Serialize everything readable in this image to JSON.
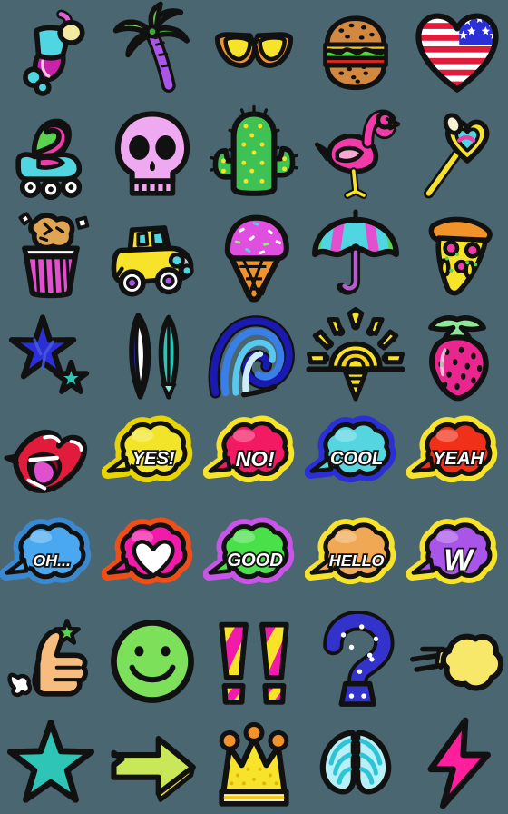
{
  "page": {
    "title": "Summer Vibes Emoji Sticker Sheet",
    "background_color": "#4a6670",
    "grid": {
      "columns": 5,
      "rows": 8,
      "cell_size_px": 112,
      "total_stickers": 40
    }
  },
  "palette": {
    "outline": "#111111",
    "cyan": "#4fd6e0",
    "magenta": "#cc22aa",
    "hot_pink": "#ff1e9c",
    "pink": "#f23aa8",
    "yellow": "#f7e32a",
    "gold": "#f5c518",
    "green": "#5ad44f",
    "leaf_green": "#57c04a",
    "blue": "#2b2fd6",
    "royal_blue": "#3333cc",
    "light_blue": "#4aa8f0",
    "orange": "#f0932b",
    "red": "#e8261c",
    "crimson": "#e01b3c",
    "purple": "#a855e8",
    "teal": "#2ec4b6",
    "skin": "#f7bd7f",
    "white": "#ffffff"
  },
  "stickers": [
    {
      "row": 1,
      "col": 1,
      "name": "cocktail-drink",
      "label": "Tropical Cocktail",
      "icon": "cocktail-icon",
      "colors": [
        "#4fd6e0",
        "#cc22aa",
        "#f7e8a0"
      ]
    },
    {
      "row": 1,
      "col": 2,
      "name": "palm-tree",
      "label": "Palm Tree",
      "icon": "palm-tree-icon",
      "colors": [
        "#57c04a",
        "#a855e8"
      ]
    },
    {
      "row": 1,
      "col": 3,
      "name": "sunglasses",
      "label": "Sunglasses",
      "icon": "sunglasses-icon",
      "colors": [
        "#f7e32a",
        "#f0932b"
      ]
    },
    {
      "row": 1,
      "col": 4,
      "name": "hamburger",
      "label": "Hamburger",
      "icon": "hamburger-icon",
      "colors": [
        "#d2883f",
        "#5ad44f",
        "#e8261c"
      ]
    },
    {
      "row": 1,
      "col": 5,
      "name": "usa-flag-heart",
      "label": "USA Flag Heart",
      "icon": "flag-heart-icon",
      "colors": [
        "#e01b3c",
        "#2b2fd6",
        "#ffffff"
      ]
    },
    {
      "row": 2,
      "col": 1,
      "name": "roller-skate",
      "label": "Roller Skate",
      "icon": "roller-skate-icon",
      "colors": [
        "#4fd6e0",
        "#f23aa8",
        "#5ad44f"
      ]
    },
    {
      "row": 2,
      "col": 2,
      "name": "skull",
      "label": "Skull",
      "icon": "skull-icon",
      "colors": [
        "#efa9f0"
      ]
    },
    {
      "row": 2,
      "col": 3,
      "name": "cactus",
      "label": "Cactus",
      "icon": "cactus-icon",
      "colors": [
        "#3fc253",
        "#f7e32a"
      ]
    },
    {
      "row": 2,
      "col": 4,
      "name": "flamingo",
      "label": "Flamingo",
      "icon": "flamingo-icon",
      "colors": [
        "#f23aa8",
        "#f9a8d4",
        "#f7e32a"
      ]
    },
    {
      "row": 2,
      "col": 5,
      "name": "heart-wand",
      "label": "Heart Magic Wand",
      "icon": "heart-wand-icon",
      "colors": [
        "#f7e32a",
        "#4fd6e0",
        "#f23aa8"
      ]
    },
    {
      "row": 3,
      "col": 1,
      "name": "popcorn",
      "label": "Popcorn Bucket",
      "icon": "popcorn-icon",
      "colors": [
        "#e44fd0",
        "#e0a552"
      ]
    },
    {
      "row": 3,
      "col": 2,
      "name": "vintage-car",
      "label": "Vintage Car",
      "icon": "vintage-car-icon",
      "colors": [
        "#f7e32a",
        "#a855e8",
        "#4fd6e0"
      ]
    },
    {
      "row": 3,
      "col": 3,
      "name": "ice-cream-cone",
      "label": "Ice Cream Cone",
      "icon": "ice-cream-icon",
      "colors": [
        "#e04fe0",
        "#f0932b"
      ]
    },
    {
      "row": 3,
      "col": 4,
      "name": "umbrella",
      "label": "Beach Umbrella",
      "icon": "umbrella-icon",
      "colors": [
        "#4fd6e0",
        "#e44fd0",
        "#5ad44f"
      ]
    },
    {
      "row": 3,
      "col": 5,
      "name": "pizza-slice",
      "label": "Pizza Slice",
      "icon": "pizza-icon",
      "colors": [
        "#f0932b",
        "#f7e32a",
        "#f23aa8"
      ]
    },
    {
      "row": 4,
      "col": 1,
      "name": "starfish",
      "label": "Starfish",
      "icon": "starfish-icon",
      "colors": [
        "#2b2fd6",
        "#2ec4b6"
      ]
    },
    {
      "row": 4,
      "col": 2,
      "name": "surfboards",
      "label": "Surfboards",
      "icon": "surfboard-icon",
      "colors": [
        "#2b2fd6",
        "#ffffff",
        "#2ec4b6"
      ]
    },
    {
      "row": 4,
      "col": 3,
      "name": "ocean-wave",
      "label": "Ocean Wave",
      "icon": "wave-icon",
      "colors": [
        "#1a1ab0",
        "#3a7fe8",
        "#9fe4f5"
      ]
    },
    {
      "row": 4,
      "col": 4,
      "name": "sunset",
      "label": "Sunset Over Water",
      "icon": "sunset-icon",
      "colors": [
        "#f7e32a",
        "#f5c518"
      ]
    },
    {
      "row": 4,
      "col": 5,
      "name": "strawberry",
      "label": "Strawberry",
      "icon": "strawberry-icon",
      "colors": [
        "#e8268e",
        "#8fe89a"
      ]
    },
    {
      "row": 5,
      "col": 1,
      "name": "lips",
      "label": "Lips With Tongue",
      "icon": "lips-icon",
      "colors": [
        "#e01b3c",
        "#e44fd0"
      ]
    },
    {
      "row": 5,
      "col": 2,
      "name": "bubble-yes",
      "label": "YES!",
      "text": "YES!",
      "icon": "speech-bubble-icon",
      "fill": "#f2e529",
      "outline": "#e8d400",
      "text_color": "#ffffff"
    },
    {
      "row": 5,
      "col": 3,
      "name": "bubble-no",
      "label": "NO!",
      "text": "NO!",
      "icon": "speech-bubble-icon",
      "fill": "#f21a62",
      "outline": "#f7e32a",
      "text_color": "#ffffff"
    },
    {
      "row": 5,
      "col": 4,
      "name": "bubble-cool",
      "label": "COOL",
      "text": "COOL",
      "icon": "speech-bubble-icon",
      "fill": "#55d5e0",
      "outline": "#2b2fd6",
      "text_color": "#ffffff"
    },
    {
      "row": 5,
      "col": 5,
      "name": "bubble-yeah",
      "label": "YEAH",
      "text": "YEAH",
      "icon": "speech-bubble-icon",
      "fill": "#f03018",
      "outline": "#f7e32a",
      "text_color": "#ffffff"
    },
    {
      "row": 6,
      "col": 1,
      "name": "bubble-oh",
      "label": "OH...",
      "text": "OH...",
      "icon": "speech-bubble-icon",
      "fill": "#4aa8f0",
      "outline": "#3a88d0",
      "text_color": "#ffffff"
    },
    {
      "row": 6,
      "col": 2,
      "name": "bubble-heart",
      "label": "Heart Bubble",
      "text": "",
      "icon": "speech-bubble-heart-icon",
      "fill": "#f21aa8",
      "outline": "#f04e18",
      "text_color": "#ffffff"
    },
    {
      "row": 6,
      "col": 3,
      "name": "bubble-good",
      "label": "GOOD",
      "text": "GOOD",
      "icon": "speech-bubble-icon",
      "fill": "#4ae04a",
      "outline": "#c855e8",
      "text_color": "#ffffff"
    },
    {
      "row": 6,
      "col": 4,
      "name": "bubble-hello",
      "label": "HELLO",
      "text": "HELLO",
      "icon": "speech-bubble-icon",
      "fill": "#f0a855",
      "outline": "#f7e32a",
      "text_color": "#ffffff"
    },
    {
      "row": 6,
      "col": 5,
      "name": "bubble-w",
      "label": "W",
      "text": "W",
      "icon": "speech-bubble-icon",
      "fill": "#a855e8",
      "outline": "#f7e32a",
      "text_color": "#ffffff"
    },
    {
      "row": 7,
      "col": 1,
      "name": "thumbs-up",
      "label": "Thumbs Up",
      "icon": "thumbs-up-icon",
      "colors": [
        "#f7bd7f",
        "#5ad44f",
        "#ffffff"
      ]
    },
    {
      "row": 7,
      "col": 2,
      "name": "smiley-face",
      "label": "Smiley Face",
      "icon": "smiley-icon",
      "colors": [
        "#7de05a"
      ]
    },
    {
      "row": 7,
      "col": 3,
      "name": "double-exclamation",
      "label": "Double Exclamation",
      "icon": "exclamation-icon",
      "colors": [
        "#f7e32a",
        "#f21aa8"
      ]
    },
    {
      "row": 7,
      "col": 4,
      "name": "question-mark",
      "label": "Question Mark",
      "icon": "question-mark-icon",
      "colors": [
        "#3333cc",
        "#ffffff"
      ]
    },
    {
      "row": 7,
      "col": 5,
      "name": "puff-cloud",
      "label": "Puff Of Air",
      "icon": "puff-cloud-icon",
      "colors": [
        "#f7e86a"
      ]
    },
    {
      "row": 8,
      "col": 1,
      "name": "star",
      "label": "Star",
      "icon": "star-icon",
      "colors": [
        "#2ec4b6"
      ]
    },
    {
      "row": 8,
      "col": 2,
      "name": "arrow-right",
      "label": "Right Arrow",
      "icon": "arrow-right-icon",
      "colors": [
        "#c8e85a",
        "#f7e32a"
      ]
    },
    {
      "row": 8,
      "col": 3,
      "name": "crown",
      "label": "Crown",
      "icon": "crown-icon",
      "colors": [
        "#f7e32a",
        "#f0932b"
      ]
    },
    {
      "row": 8,
      "col": 4,
      "name": "angel-wings",
      "label": "Angel Wings",
      "icon": "wings-icon",
      "colors": [
        "#4fd6e0",
        "#b8f0f5"
      ]
    },
    {
      "row": 8,
      "col": 5,
      "name": "lightning-bolt",
      "label": "Lightning Bolt",
      "icon": "lightning-icon",
      "colors": [
        "#ff1e9c"
      ]
    }
  ]
}
